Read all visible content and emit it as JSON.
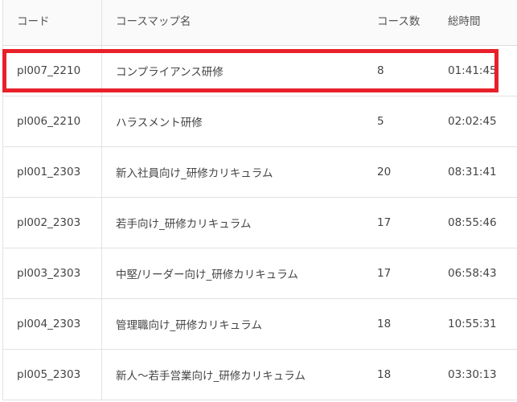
{
  "table": {
    "headers": {
      "code": "コード",
      "name": "コースマップ名",
      "count": "コース数",
      "time": "総時間"
    },
    "rows": [
      {
        "code": "pl007_2210",
        "name": "コンプライアンス研修",
        "count": "8",
        "time": "01:41:45",
        "highlighted": true
      },
      {
        "code": "pl006_2210",
        "name": "ハラスメント研修",
        "count": "5",
        "time": "02:02:45"
      },
      {
        "code": "pl001_2303",
        "name": "新入社員向け_研修カリキュラム",
        "count": "20",
        "time": "08:31:41"
      },
      {
        "code": "pl002_2303",
        "name": "若手向け_研修カリキュラム",
        "count": "17",
        "time": "08:55:46"
      },
      {
        "code": "pl003_2303",
        "name": "中堅/リーダー向け_研修カリキュラム",
        "count": "17",
        "time": "06:58:43"
      },
      {
        "code": "pl004_2303",
        "name": "管理職向け_研修カリキュラム",
        "count": "18",
        "time": "10:55:31"
      },
      {
        "code": "pl005_2303",
        "name": "新人～若手営業向け_研修カリキュラム",
        "count": "18",
        "time": "03:30:13"
      }
    ]
  },
  "colors": {
    "highlight": "#e8202a",
    "border": "#e2e2e2",
    "text": "#444444"
  }
}
